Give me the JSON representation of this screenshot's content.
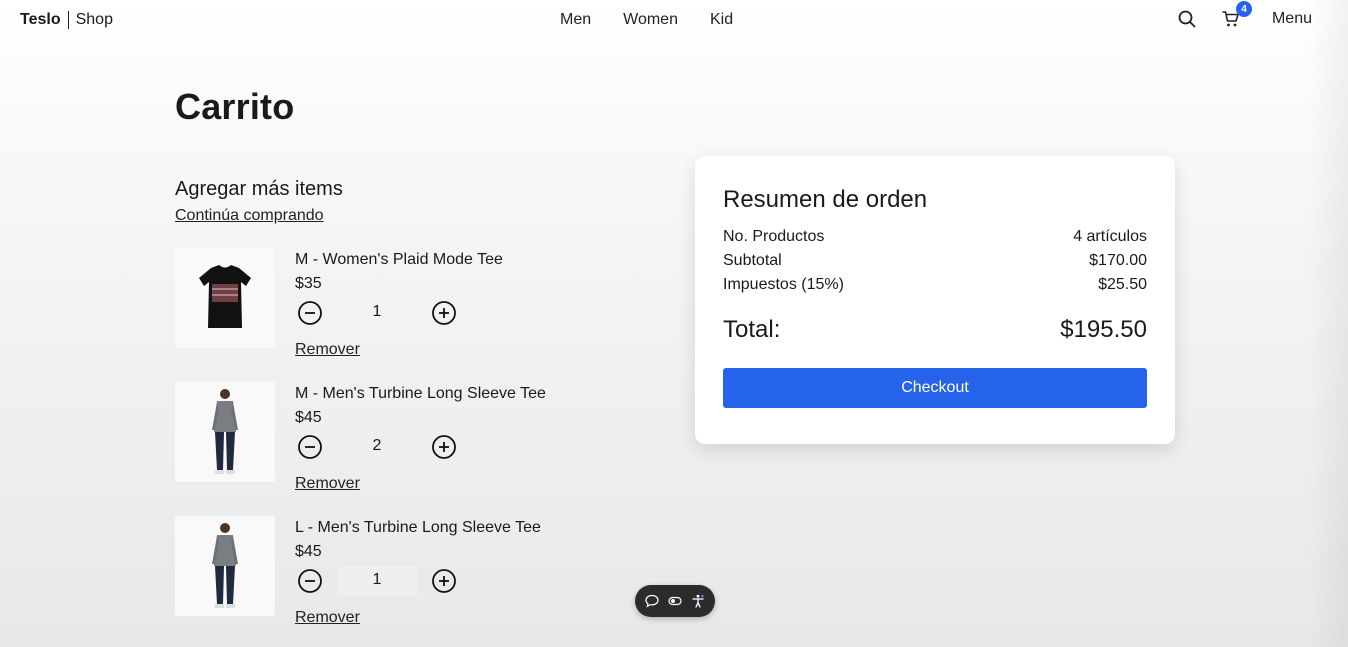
{
  "header": {
    "brand_bold": "Teslo",
    "brand_light": "Shop",
    "nav": [
      "Men",
      "Women",
      "Kid"
    ],
    "cart_count": "4",
    "menu_label": "Menu"
  },
  "page": {
    "title": "Carrito",
    "add_more": "Agregar más items",
    "continue_link": "Continúa comprando"
  },
  "cart": {
    "remove_label": "Remover",
    "items": [
      {
        "title": "M - Women's Plaid Mode Tee",
        "price": "$35",
        "qty": "1"
      },
      {
        "title": "M - Men's Turbine Long Sleeve Tee",
        "price": "$45",
        "qty": "2"
      },
      {
        "title": "L - Men's Turbine Long Sleeve Tee",
        "price": "$45",
        "qty": "1"
      }
    ]
  },
  "summary": {
    "title": "Resumen de orden",
    "rows": [
      {
        "label": "No. Productos",
        "value": "4 artículos"
      },
      {
        "label": "Subtotal",
        "value": "$170.00"
      },
      {
        "label": "Impuestos (15%)",
        "value": "$25.50"
      }
    ],
    "total_label": "Total:",
    "total_value": "$195.50",
    "checkout_label": "Checkout"
  },
  "colors": {
    "accent": "#2563eb"
  },
  "icons": [
    "search-icon",
    "cart-icon",
    "minus-circle-icon",
    "plus-circle-icon",
    "chat-icon",
    "toggle-icon",
    "accessibility-icon"
  ]
}
